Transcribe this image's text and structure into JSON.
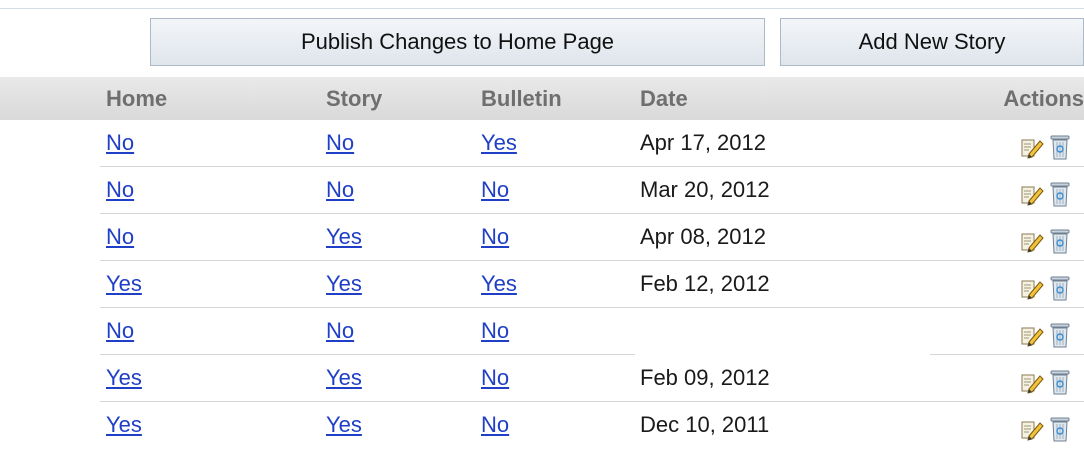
{
  "toolbar": {
    "publish_label": "Publish Changes to Home Page",
    "add_label": "Add New Story"
  },
  "table": {
    "headers": {
      "home": "Home",
      "story": "Story",
      "bulletin": "Bulletin",
      "date": "Date",
      "actions": "Actions"
    },
    "rows": [
      {
        "home": "No",
        "story": "No",
        "bulletin": "Yes",
        "date": "Apr 17, 2012"
      },
      {
        "home": "No",
        "story": "No",
        "bulletin": "No",
        "date": "Mar 20, 2012"
      },
      {
        "home": "No",
        "story": "Yes",
        "bulletin": "No",
        "date": "Apr 08, 2012"
      },
      {
        "home": "Yes",
        "story": "Yes",
        "bulletin": "Yes",
        "date": "Feb 12, 2012"
      },
      {
        "home": "No",
        "story": "No",
        "bulletin": "No",
        "date": ""
      },
      {
        "home": "Yes",
        "story": "Yes",
        "bulletin": "No",
        "date": "Feb 09, 2012"
      },
      {
        "home": "Yes",
        "story": "Yes",
        "bulletin": "No",
        "date": "Dec 10, 2011"
      }
    ],
    "action_icons": [
      "edit-icon",
      "trash-icon"
    ]
  },
  "colors": {
    "link": "#1f3fc7",
    "header_text": "#6f6f6f",
    "header_bg": "#e0e0e0"
  }
}
